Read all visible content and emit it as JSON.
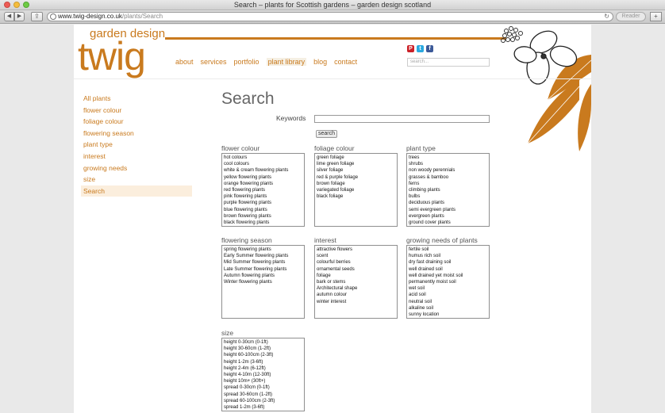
{
  "window": {
    "title": "Search – plants for Scottish gardens – garden design scotland"
  },
  "browser": {
    "url_host": "www.twig-design.co.uk",
    "url_path": "/plants/Search",
    "reader_label": "Reader"
  },
  "site": {
    "logo_small": "garden design",
    "logo_big": "twig",
    "nav": [
      "about",
      "services",
      "portfolio",
      "plant library",
      "blog",
      "contact"
    ],
    "search_placeholder": "search...",
    "accent_color": "#c97a1e"
  },
  "sidebar": {
    "items": [
      "All plants",
      "flower colour",
      "foliage colour",
      "flowering season",
      "plant type",
      "interest",
      "growing needs",
      "size",
      "Search"
    ]
  },
  "main": {
    "title": "Search",
    "keywords_label": "Keywords",
    "search_button": "search",
    "filters": [
      {
        "title": "flower colour",
        "options": [
          "hot colours",
          "cool colours",
          "white & cream flowering plants",
          "yellow flowering plants",
          "orange flowering plants",
          "red flowering plants",
          "pink flowering plants",
          "purple flowering plants",
          "blue flowering plants",
          "brown flowering plants",
          "black flowering plants"
        ]
      },
      {
        "title": "foliage colour",
        "options": [
          "green foliage",
          "lime green foliage",
          "silver foliage",
          "red & purple foliage",
          "brown foliage",
          "variegated foliage",
          "black foliage"
        ]
      },
      {
        "title": "plant type",
        "options": [
          "trees",
          "shrubs",
          "non woody perennials",
          "grasses & bamboo",
          "ferns",
          "climbing plants",
          "bulbs",
          "deciduous plants",
          "semi evergreen plants",
          "evergreen plants",
          "ground cover plants"
        ]
      },
      {
        "title": "flowering season",
        "options": [
          "spring flowering plants",
          "Early Summer flowering plants",
          "Mid Summer flowering plants",
          "Late Summer flowering plants",
          "Autumn flowering plants",
          "Winter flowering plants"
        ]
      },
      {
        "title": "interest",
        "options": [
          "attractive flowers",
          "scent",
          "colourful berries",
          "ornamental seeds",
          "foliage",
          "bark or stems",
          "Architectural shape",
          "autumn colour",
          "winter interest"
        ]
      },
      {
        "title": "growing needs of plants",
        "options": [
          "fertile soil",
          "humus rich soil",
          "dry fast draining soil",
          "well drained soil",
          "well drained yet moist soil",
          "permanently moist soil",
          "wet soil",
          "acid soil",
          "neutral soil",
          "alkaline soil",
          "sunny location"
        ]
      },
      {
        "title": "size",
        "options": [
          "height 0-30cm (0-1ft)",
          "height 30-60cm (1-2ft)",
          "height 60-100cm (2-3ft)",
          "height 1-2m (3-6ft)",
          "height 2-4m (6-12ft)",
          "height 4-10m (12-30ft)",
          "height 10m+ (30ft+)",
          "spread 0-30cm (0-1ft)",
          "spread 30-60cm (1-2ft)",
          "spread 60-100cm (2-3ft)",
          "spread 1-2m (3-6ft)"
        ]
      }
    ]
  }
}
